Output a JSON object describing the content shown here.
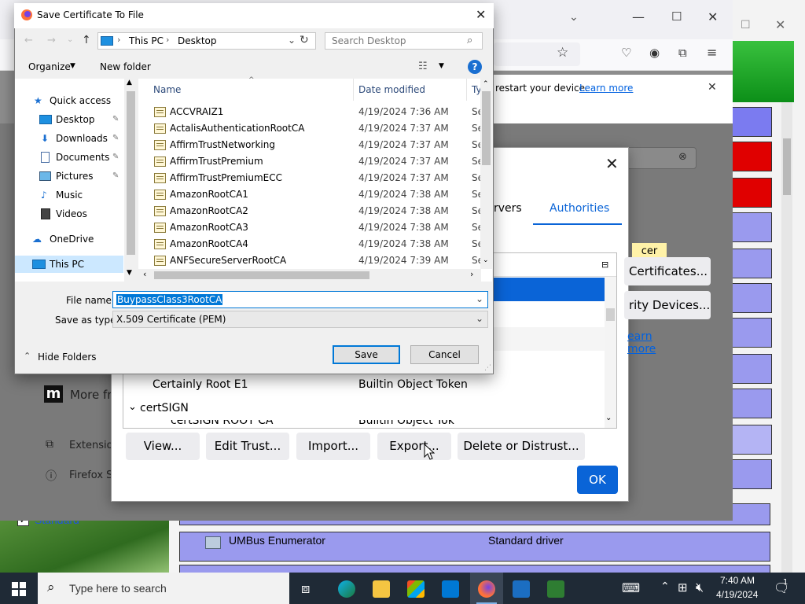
{
  "file_dialog": {
    "title": "Save Certificate To File",
    "address": {
      "segments": [
        "This PC",
        "Desktop"
      ]
    },
    "search_placeholder": "Search Desktop",
    "toolbar": {
      "organize": "Organize",
      "new_folder": "New folder"
    },
    "tree": [
      {
        "label": "Quick access",
        "icon": "star-icon",
        "indent": 0
      },
      {
        "label": "Desktop",
        "icon": "desktop-folder-icon",
        "indent": 1,
        "pinned": true
      },
      {
        "label": "Downloads",
        "icon": "download-icon",
        "indent": 1,
        "pinned": true
      },
      {
        "label": "Documents",
        "icon": "document-icon",
        "indent": 1,
        "pinned": true
      },
      {
        "label": "Pictures",
        "icon": "picture-icon",
        "indent": 1,
        "pinned": true
      },
      {
        "label": "Music",
        "icon": "music-icon",
        "indent": 1
      },
      {
        "label": "Videos",
        "icon": "video-icon",
        "indent": 1
      },
      {
        "label": "OneDrive",
        "icon": "cloud-icon",
        "indent": 0
      },
      {
        "label": "This PC",
        "icon": "computer-icon",
        "indent": 0,
        "selected": true
      }
    ],
    "columns": {
      "name": "Name",
      "date": "Date modified",
      "type": "Ty"
    },
    "files": [
      {
        "name": "ACCVRAIZ1",
        "date": "4/19/2024 7:36 AM",
        "type": "Se"
      },
      {
        "name": "ActalisAuthenticationRootCA",
        "date": "4/19/2024 7:37 AM",
        "type": "Se"
      },
      {
        "name": "AffirmTrustNetworking",
        "date": "4/19/2024 7:37 AM",
        "type": "Se"
      },
      {
        "name": "AffirmTrustPremium",
        "date": "4/19/2024 7:37 AM",
        "type": "Se"
      },
      {
        "name": "AffirmTrustPremiumECC",
        "date": "4/19/2024 7:37 AM",
        "type": "Se"
      },
      {
        "name": "AmazonRootCA1",
        "date": "4/19/2024 7:38 AM",
        "type": "Se"
      },
      {
        "name": "AmazonRootCA2",
        "date": "4/19/2024 7:38 AM",
        "type": "Se"
      },
      {
        "name": "AmazonRootCA3",
        "date": "4/19/2024 7:38 AM",
        "type": "Se"
      },
      {
        "name": "AmazonRootCA4",
        "date": "4/19/2024 7:38 AM",
        "type": "Se"
      },
      {
        "name": "ANFSecureServerRootCA",
        "date": "4/19/2024 7:39 AM",
        "type": "Se"
      }
    ],
    "file_name_label": "File name:",
    "file_name_value": "BuypassClass3RootCA",
    "save_type_label": "Save as type:",
    "save_type_value": "X.509 Certificate (PEM)",
    "hide_folders": "Hide Folders",
    "save": "Save",
    "cancel": "Cancel"
  },
  "cert_manager": {
    "tab_servers_partial": "rvers",
    "tab_authorities": "Authorities",
    "side_tag": "cer",
    "side_certificates": "Certificates...",
    "side_devices": "rity Devices...",
    "side_learn_more": "earn more",
    "rows": [
      {
        "name": "Certainly Root E1",
        "token": "Builtin Object Token"
      },
      {
        "group": "certSIGN"
      }
    ],
    "row_cut": "certSIGN ROOT CA",
    "row_cut_token": "Builtin Object Tok",
    "buttons": {
      "view": "View...",
      "edit_trust": "Edit Trust...",
      "import": "Import...",
      "export": "Export...",
      "delete": "Delete or Distrust..."
    },
    "ok": "OK"
  },
  "firefox": {
    "notice_text": "restart your device.",
    "notice_link": "Learn more",
    "sidebar_more": "More fr",
    "sidebar_extensions": "Extension",
    "sidebar_support": "Firefox S"
  },
  "background_app": {
    "checkbox_label": "Standard",
    "row_name": "UMBus Enumerator",
    "row_driver": "Standard driver"
  },
  "taskbar": {
    "search_placeholder": "Type here to search",
    "time": "7:40 AM",
    "date": "4/19/2024",
    "notification_count": "1"
  },
  "colors": {
    "accent": "#0a64d7",
    "selection": "#0078d7",
    "taskbar": "#1f2a36"
  }
}
